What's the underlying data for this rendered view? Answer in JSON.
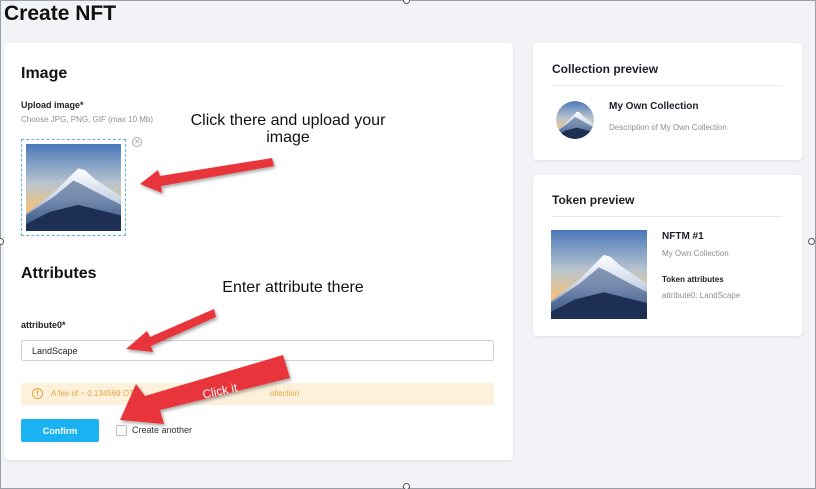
{
  "page": {
    "title": "Create NFT"
  },
  "image_section": {
    "title": "Image",
    "upload_label": "Upload image*",
    "upload_hint": "Choose JPG, PNG, GIF (max 10 Mb)",
    "remove_icon": "close-circle-icon"
  },
  "attributes_section": {
    "title": "Attributes",
    "field_label": "attribute0*",
    "field_value": "LandScape"
  },
  "fee": {
    "icon": "info-icon",
    "text_before": "A fee of ~ 0.134569 OT",
    "text_after": "ollection"
  },
  "actions": {
    "confirm_label": "Confirm",
    "create_another_label": "Create another"
  },
  "collection_preview": {
    "title": "Collection preview",
    "name": "My Own Collection",
    "description": "Description of My Own Collection"
  },
  "token_preview": {
    "title": "Token preview",
    "token_name": "NFTM #1",
    "collection_name": "My Own Collection",
    "attributes_title": "Token attributes",
    "attribute_line": "attribute0: LandScape"
  },
  "annotations": {
    "upload_note_line1": "Click there and upload your",
    "upload_note_line2": "image",
    "attribute_note": "Enter attribute there",
    "click_note": "Click it"
  },
  "colors": {
    "accent": "#1ab2f0",
    "fee_bg": "#fdf1dc",
    "fee_text": "#e8a33c",
    "arrow": "#e8353a"
  }
}
